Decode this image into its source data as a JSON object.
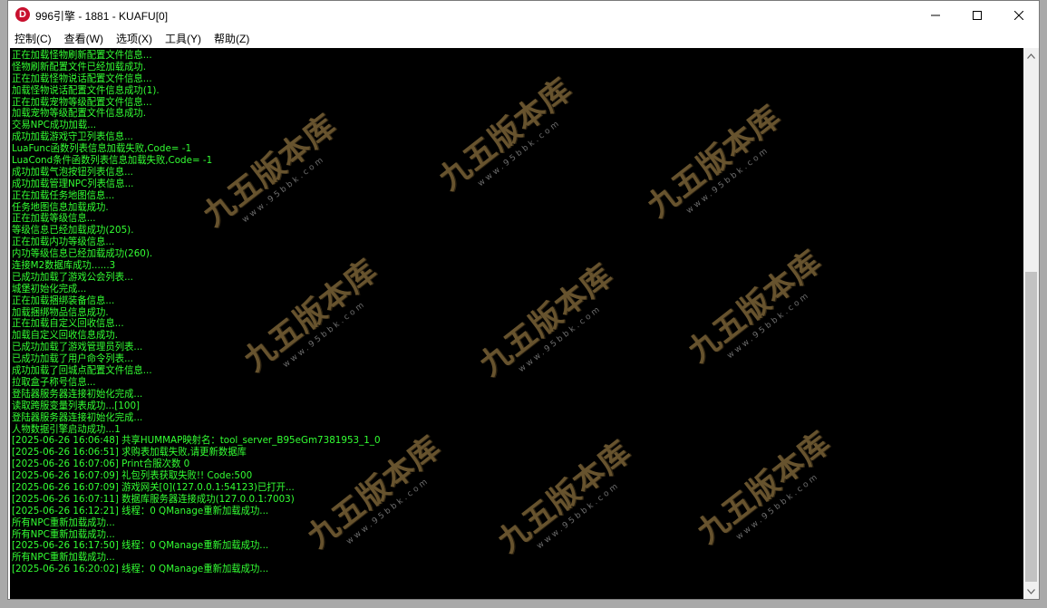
{
  "window": {
    "title": "996引擎 - 1881 - KUAFU[0]",
    "icon_letter": "D",
    "icon_color": "#c8102e"
  },
  "window_controls": {
    "minimize": "minimize-icon",
    "maximize": "maximize-icon",
    "close": "close-icon"
  },
  "menu": {
    "items": [
      {
        "label": "控制(C)"
      },
      {
        "label": "查看(W)"
      },
      {
        "label": "选项(X)"
      },
      {
        "label": "工具(Y)"
      },
      {
        "label": "帮助(Z)"
      }
    ]
  },
  "console": {
    "background": "#000000",
    "text_color": "#33ff33",
    "lines": [
      "正在加载怪物刷新配置文件信息...",
      "怪物刷新配置文件已经加载成功.",
      "正在加载怪物说话配置文件信息...",
      "加载怪物说话配置文件信息成功(1).",
      "正在加载宠物等级配置文件信息...",
      "加载宠物等级配置文件信息成功.",
      "交易NPC成功加载...",
      "成功加载游戏守卫列表信息...",
      "LuaFunc函数列表信息加载失败,Code= -1",
      "LuaCond条件函数列表信息加载失败,Code= -1",
      "成功加载气泡按钮列表信息...",
      "成功加载管理NPC列表信息...",
      "正在加载任务地图信息...",
      "任务地图信息加载成功.",
      "正在加载等级信息...",
      "等级信息已经加载成功(205).",
      "正在加载内功等级信息...",
      "内功等级信息已经加载成功(260).",
      "连接M2数据库成功......3",
      "已成功加载了游戏公会列表...",
      "城堡初始化完成...",
      "正在加载捆绑装备信息...",
      "加载捆绑物品信息成功.",
      "正在加载自定义回收信息...",
      "加载自定义回收信息成功.",
      "已成功加载了游戏管理员列表...",
      "已成功加载了用户命令列表...",
      "成功加载了回城点配置文件信息...",
      "拉取盒子称号信息...",
      "登陆器服务器连接初始化完成...",
      "读取跨服变量列表成功...[100]",
      "登陆器服务器连接初始化完成...",
      "人物数据引擎启动成功...1",
      "[2025-06-26 16:06:48] 共享HUMMAP映射名：tool_server_B95eGm7381953_1_0",
      "[2025-06-26 16:06:51] 求购表加载失败,请更新数据库",
      "[2025-06-26 16:07:06] Print合服次数 0",
      "[2025-06-26 16:07:09] 礼包列表获取失败!! Code:500",
      "[2025-06-26 16:07:09] 游戏网关[0](127.0.0.1:54123)已打开...",
      "[2025-06-26 16:07:11] 数据库服务器连接成功(127.0.0.1:7003)",
      "[2025-06-26 16:12:21] 线程：0 QManage重新加载成功...",
      "所有NPC重新加载成功...",
      "所有NPC重新加载成功...",
      "[2025-06-26 16:17:50] 线程：0 QManage重新加载成功...",
      "所有NPC重新加载成功...",
      "[2025-06-26 16:20:02] 线程：0 QManage重新加载成功..."
    ]
  },
  "watermark": {
    "text": "九五版本库",
    "url": "www.95bbk.com",
    "color": "#8a6f3e"
  },
  "scrollbar": {
    "up": "scroll-up-arrow-icon",
    "down": "scroll-down-arrow-icon"
  }
}
